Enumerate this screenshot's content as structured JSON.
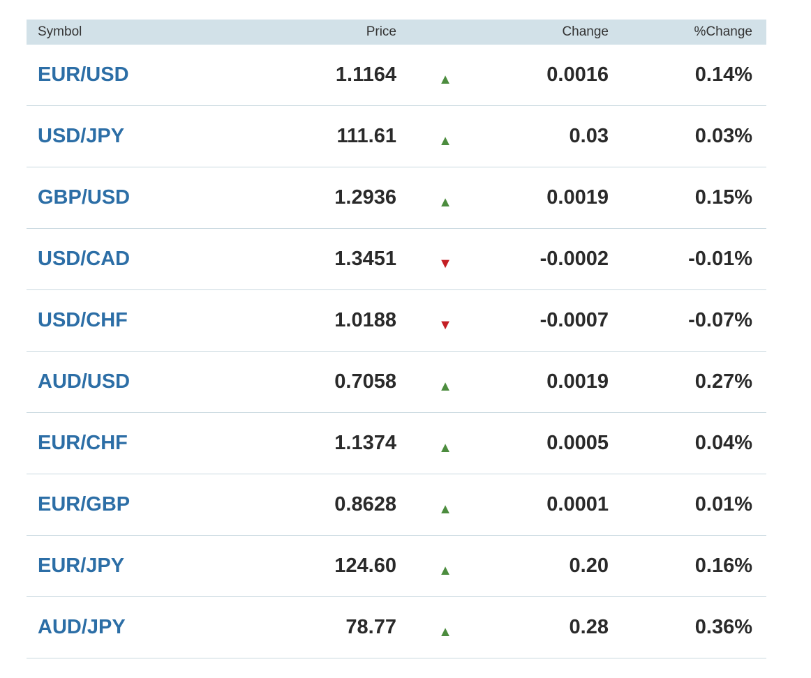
{
  "headers": {
    "symbol": "Symbol",
    "price": "Price",
    "change": "Change",
    "pct_change": "%Change"
  },
  "colors": {
    "header_bg": "#d2e1e8",
    "symbol_link": "#2c6ea6",
    "up": "#4c8c3e",
    "down": "#c41e24"
  },
  "rows": [
    {
      "symbol": "EUR/USD",
      "price": "1.1164",
      "direction": "up",
      "arrow_icon": "▲",
      "change": "0.0016",
      "pct_change": "0.14%"
    },
    {
      "symbol": "USD/JPY",
      "price": "111.61",
      "direction": "up",
      "arrow_icon": "▲",
      "change": "0.03",
      "pct_change": "0.03%"
    },
    {
      "symbol": "GBP/USD",
      "price": "1.2936",
      "direction": "up",
      "arrow_icon": "▲",
      "change": "0.0019",
      "pct_change": "0.15%"
    },
    {
      "symbol": "USD/CAD",
      "price": "1.3451",
      "direction": "down",
      "arrow_icon": "▼",
      "change": "-0.0002",
      "pct_change": "-0.01%"
    },
    {
      "symbol": "USD/CHF",
      "price": "1.0188",
      "direction": "down",
      "arrow_icon": "▼",
      "change": "-0.0007",
      "pct_change": "-0.07%"
    },
    {
      "symbol": "AUD/USD",
      "price": "0.7058",
      "direction": "up",
      "arrow_icon": "▲",
      "change": "0.0019",
      "pct_change": "0.27%"
    },
    {
      "symbol": "EUR/CHF",
      "price": "1.1374",
      "direction": "up",
      "arrow_icon": "▲",
      "change": "0.0005",
      "pct_change": "0.04%"
    },
    {
      "symbol": "EUR/GBP",
      "price": "0.8628",
      "direction": "up",
      "arrow_icon": "▲",
      "change": "0.0001",
      "pct_change": "0.01%"
    },
    {
      "symbol": "EUR/JPY",
      "price": "124.60",
      "direction": "up",
      "arrow_icon": "▲",
      "change": "0.20",
      "pct_change": "0.16%"
    },
    {
      "symbol": "AUD/JPY",
      "price": "78.77",
      "direction": "up",
      "arrow_icon": "▲",
      "change": "0.28",
      "pct_change": "0.36%"
    }
  ]
}
